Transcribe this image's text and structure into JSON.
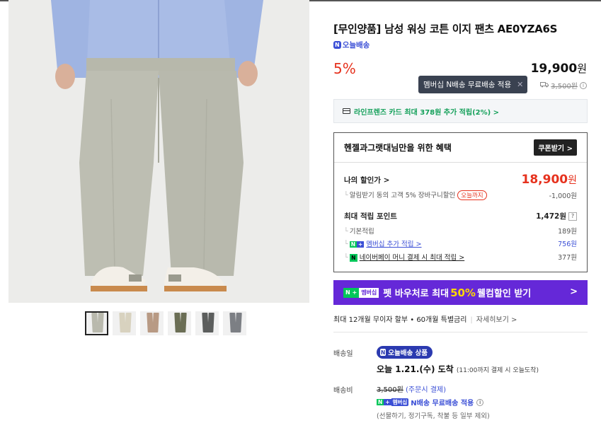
{
  "product": {
    "title": "[무인양품] 남성 워싱 코튼 이지 팬츠 AE0YZA6S",
    "delivery_tag": "오늘배송",
    "discount": "5%",
    "price": "19,900",
    "currency": "원"
  },
  "shipping_tooltip": {
    "text": "멤버십 N배송 무료배송 적용",
    "close": "✕"
  },
  "shipping_old": {
    "fee": "3,500원"
  },
  "card_banner": "라인프렌즈 카드 최대 378원 추가 적립(2%) >",
  "benefit": {
    "title": "헨젤과그랫대님만을 위한 혜택",
    "coupon_button": "쿠폰받기 >",
    "my_price_label": "나의 할인가 >",
    "my_price": "18,900",
    "my_price_unit": "원",
    "alarm_note": "알림받기 동의 고객 5% 장바구니할인",
    "alarm_badge": "오늘까지",
    "alarm_value": "-1,000원",
    "points_label": "최대 적립 포인트",
    "points_value": "1,472원",
    "points_q": "?",
    "basic_label": "기본적립",
    "basic_value": "189원",
    "member_label": "멤버십 추가 적립 >",
    "member_value": "756원",
    "npay_label": "네이버페이 머니 결제 시 최대 적립 >",
    "npay_value": "377원"
  },
  "pet_banner": {
    "badge_n": "N +",
    "badge_member": "멤버십",
    "text_before": "펫 바우처로 최대",
    "highlight": "50%",
    "text_after": "웰컴할인 받기",
    "arrow": ">"
  },
  "installment": {
    "text": "최대 12개월 무이자 할부 • 60개월 특별금리",
    "more": "자세히보기 >"
  },
  "delivery": {
    "label": "배송일",
    "pill": "오늘배송 상품",
    "arrive": "오늘 1.21.(수) 도착",
    "arrive_note": "(11:00까지 결제 시 오늘도착)"
  },
  "fee": {
    "label": "배송비",
    "old": "3,500원",
    "note": "(주문시 결제)",
    "member_badge": "멤버십",
    "free_text": "N배송 무료배송 적용",
    "exclusions": "(선물하기, 정기구독, 착불 등 일부 제외)"
  },
  "badges": {
    "n": "N",
    "plus": "+",
    "n_small": "N"
  },
  "colors": {
    "discount_red": "#e6321e",
    "naver_green": "#03c75a",
    "delivery_blue": "#3b4fd6",
    "banner_purple": "#6528d8",
    "highlight_yellow": "#ffd800"
  },
  "thumbnails": [
    {
      "color": "#b9b9ad",
      "selected": true
    },
    {
      "color": "#d8d2bf",
      "selected": false
    },
    {
      "color": "#b89a84",
      "selected": false
    },
    {
      "color": "#6b6e55",
      "selected": false
    },
    {
      "color": "#5c5e5d",
      "selected": false
    },
    {
      "color": "#7c7f84",
      "selected": false
    }
  ]
}
